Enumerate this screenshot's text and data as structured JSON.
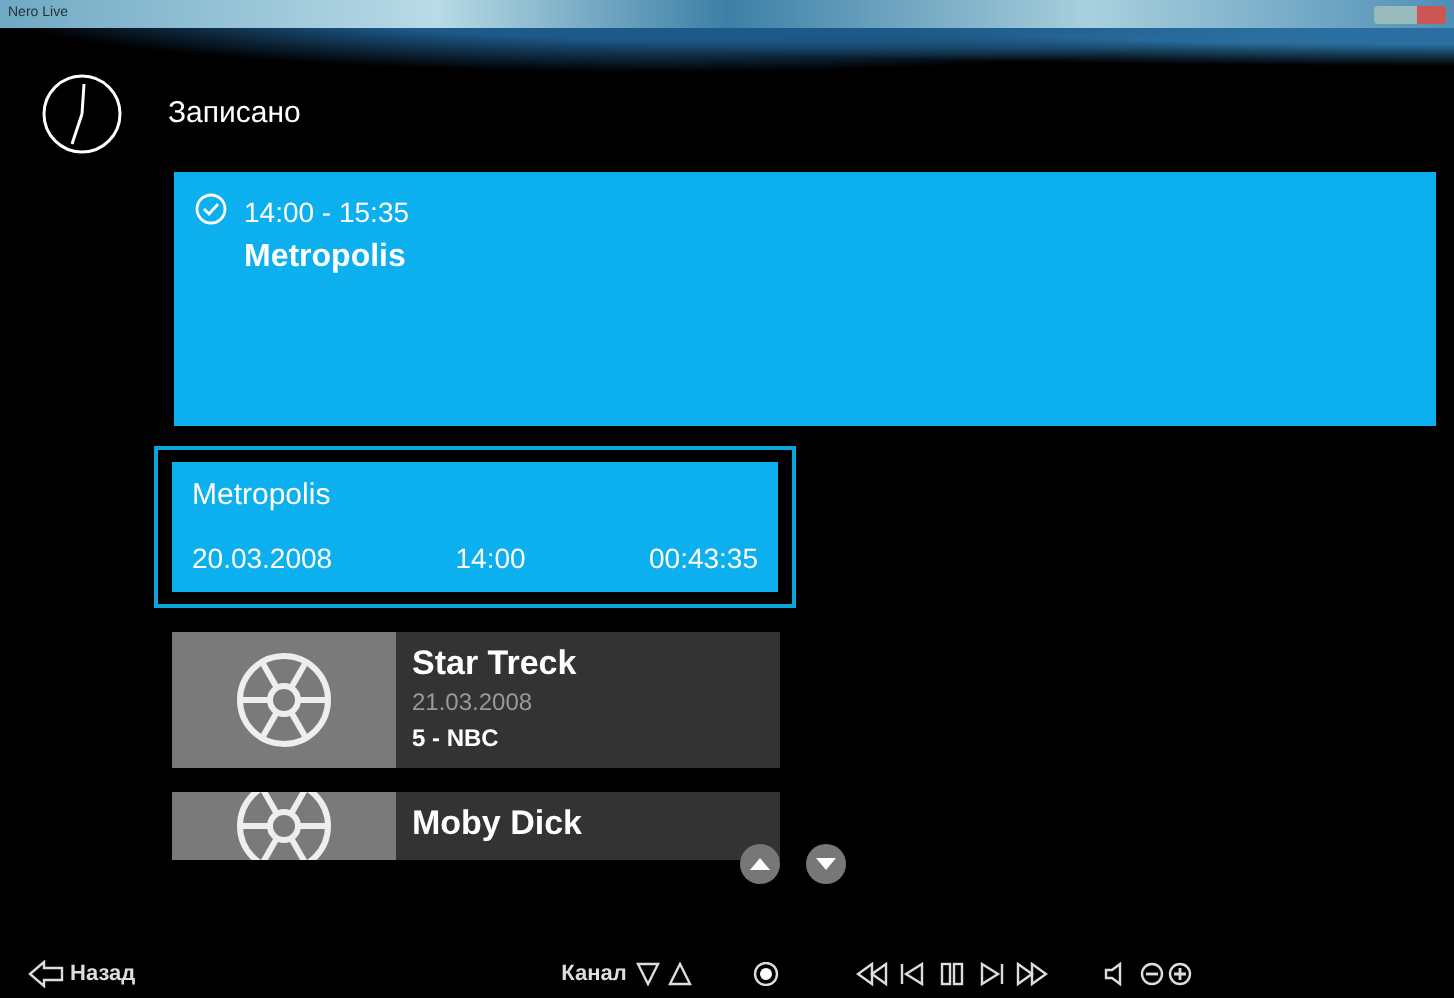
{
  "window": {
    "title": "Nero Live"
  },
  "header": {
    "title": "Записано"
  },
  "featured": {
    "checked": true,
    "time": "14:00 - 15:35",
    "title": "Metropolis"
  },
  "recordings": [
    {
      "title": "Metropolis",
      "date": "20.03.2008",
      "time": "14:00",
      "duration": "00:43:35",
      "selected": true
    },
    {
      "title": "Star Treck",
      "date": "21.03.2008",
      "channel": "5 - NBC",
      "selected": false
    },
    {
      "title": "Moby Dick",
      "selected": false
    }
  ],
  "bottom_bar": {
    "back_label": "Назад",
    "channel_label": "Канал"
  }
}
